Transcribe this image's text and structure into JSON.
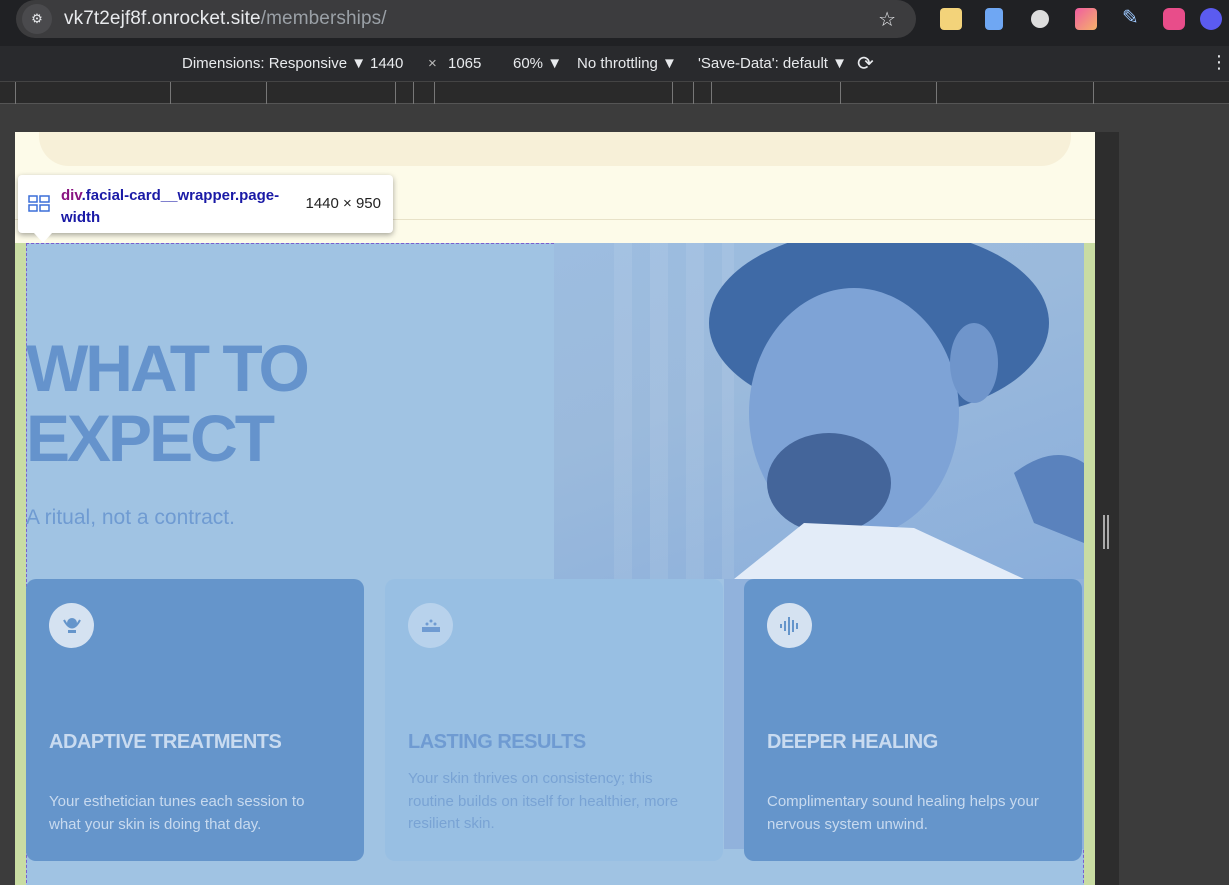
{
  "browser": {
    "url_host": "vk7t2ejf8f.onrocket.site",
    "url_path": "/memberships/"
  },
  "devtools": {
    "dimensions_label": "Dimensions: Responsive ▼",
    "width": "1440",
    "times": "×",
    "height": "1065",
    "zoom": "60% ▼",
    "throttling": "No throttling ▼",
    "save_data": "'Save-Data': default ▼"
  },
  "inspector_tooltip": {
    "tag": "div",
    "selector": ".facial-card__wrapper.page-width",
    "size": "1440 × 950"
  },
  "page": {
    "title": "WHAT TO EXPECT",
    "subtitle": "A ritual, not a contract.",
    "cards": [
      {
        "icon": "face-care-icon",
        "title": "ADAPTIVE TREATMENTS",
        "text": "Your esthetician tunes each session to what your skin is doing that day."
      },
      {
        "icon": "spa-tray-icon",
        "title": "LASTING RESULTS",
        "text": "Your skin thrives on consistency; this routine builds on itself for healthier, more resilient skin."
      },
      {
        "icon": "sound-wave-icon",
        "title": "DEEPER HEALING",
        "text": "Complimentary sound healing helps your nervous system unwind."
      }
    ]
  },
  "colors": {
    "accent": "#6595cb",
    "wrapper_bg": "#a0c3e3",
    "page_bg": "#fdfbe9"
  }
}
